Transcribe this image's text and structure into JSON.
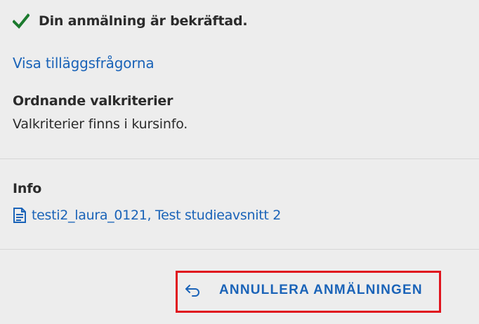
{
  "status": {
    "icon": "checkmark-icon",
    "text": "Din anmälning är bekräftad.",
    "color": "#1c7a2e"
  },
  "extra_questions_link": "Visa tilläggsfrågorna",
  "criteria": {
    "heading": "Ordnande valkriterier",
    "text": "Valkriterier finns i kursinfo."
  },
  "info": {
    "heading": "Info",
    "icon": "document-icon",
    "link_text": "testi2_laura_0121, Test studieavsnitt 2"
  },
  "cancel_button": {
    "icon": "undo-arrow-icon",
    "label": "ANNULLERA ANMÄLNINGEN"
  },
  "colors": {
    "link": "#1a63b8",
    "highlight_border": "#e0141e",
    "background": "#ededed"
  }
}
